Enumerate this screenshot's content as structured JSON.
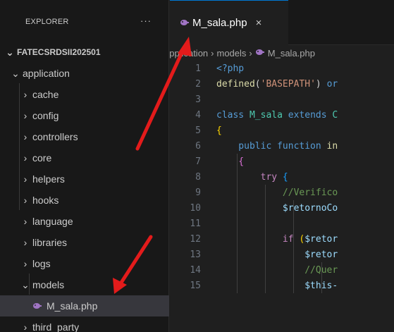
{
  "explorer": {
    "title": "EXPLORER",
    "more_actions": "···",
    "project": "FATECSRDSII202501",
    "items": [
      {
        "label": "application",
        "expanded": true,
        "depth": 1
      },
      {
        "label": "cache",
        "expanded": false,
        "depth": 2
      },
      {
        "label": "config",
        "expanded": false,
        "depth": 2
      },
      {
        "label": "controllers",
        "expanded": false,
        "depth": 2
      },
      {
        "label": "core",
        "expanded": false,
        "depth": 2
      },
      {
        "label": "helpers",
        "expanded": false,
        "depth": 2
      },
      {
        "label": "hooks",
        "expanded": false,
        "depth": 2
      },
      {
        "label": "language",
        "expanded": false,
        "depth": 2
      },
      {
        "label": "libraries",
        "expanded": false,
        "depth": 2
      },
      {
        "label": "logs",
        "expanded": false,
        "depth": 2
      },
      {
        "label": "models",
        "expanded": true,
        "depth": 2
      },
      {
        "label": "M_sala.php",
        "file": true,
        "selected": true,
        "depth": 3
      },
      {
        "label": "third_party",
        "expanded": false,
        "depth": 2
      }
    ]
  },
  "editor": {
    "tab": {
      "label": "M_sala.php",
      "close": "×",
      "icon": "php-elephant-icon"
    },
    "breadcrumb": [
      "application",
      "models",
      "M_sala.php"
    ],
    "lines": [
      {
        "n": "1",
        "tokens": [
          {
            "t": "<?php",
            "c": "#569cd6"
          }
        ]
      },
      {
        "n": "2",
        "tokens": [
          {
            "t": "defined",
            "c": "#dcdcaa"
          },
          {
            "t": "(",
            "c": "#d4d4d4"
          },
          {
            "t": "'BASEPATH'",
            "c": "#ce9178"
          },
          {
            "t": ") ",
            "c": "#d4d4d4"
          },
          {
            "t": "or",
            "c": "#569cd6"
          }
        ]
      },
      {
        "n": "3",
        "tokens": []
      },
      {
        "n": "4",
        "tokens": [
          {
            "t": "class ",
            "c": "#569cd6"
          },
          {
            "t": "M_sala ",
            "c": "#4ec9b0"
          },
          {
            "t": "extends ",
            "c": "#569cd6"
          },
          {
            "t": "C",
            "c": "#4ec9b0"
          }
        ]
      },
      {
        "n": "5",
        "tokens": [
          {
            "t": "{",
            "c": "#ffd700"
          }
        ]
      },
      {
        "n": "6",
        "tokens": [
          {
            "t": "    public ",
            "c": "#569cd6"
          },
          {
            "t": "function ",
            "c": "#569cd6"
          },
          {
            "t": "in",
            "c": "#dcdcaa"
          }
        ]
      },
      {
        "n": "7",
        "tokens": [
          {
            "t": "    {",
            "c": "#da70d6"
          }
        ]
      },
      {
        "n": "8",
        "tokens": [
          {
            "t": "        try ",
            "c": "#c586c0"
          },
          {
            "t": "{",
            "c": "#179fff"
          }
        ]
      },
      {
        "n": "9",
        "tokens": [
          {
            "t": "            //Verifico",
            "c": "#6a9955"
          }
        ]
      },
      {
        "n": "10",
        "tokens": [
          {
            "t": "            $retornoCo",
            "c": "#9cdcfe"
          }
        ]
      },
      {
        "n": "11",
        "tokens": []
      },
      {
        "n": "12",
        "tokens": [
          {
            "t": "            if ",
            "c": "#c586c0"
          },
          {
            "t": "(",
            "c": "#ffd700"
          },
          {
            "t": "$retor",
            "c": "#9cdcfe"
          }
        ]
      },
      {
        "n": "13",
        "tokens": [
          {
            "t": "                $retor",
            "c": "#9cdcfe"
          }
        ]
      },
      {
        "n": "14",
        "tokens": [
          {
            "t": "                //Quer",
            "c": "#6a9955"
          }
        ]
      },
      {
        "n": "15",
        "tokens": [
          {
            "t": "                $this-",
            "c": "#9cdcfe"
          }
        ]
      }
    ]
  },
  "colors": {
    "sidebar_bg": "#181818",
    "editor_bg": "#1f1f1f",
    "selection_bg": "#37373d",
    "php_icon": "#a074c4",
    "arrow": "#e31b1b"
  }
}
